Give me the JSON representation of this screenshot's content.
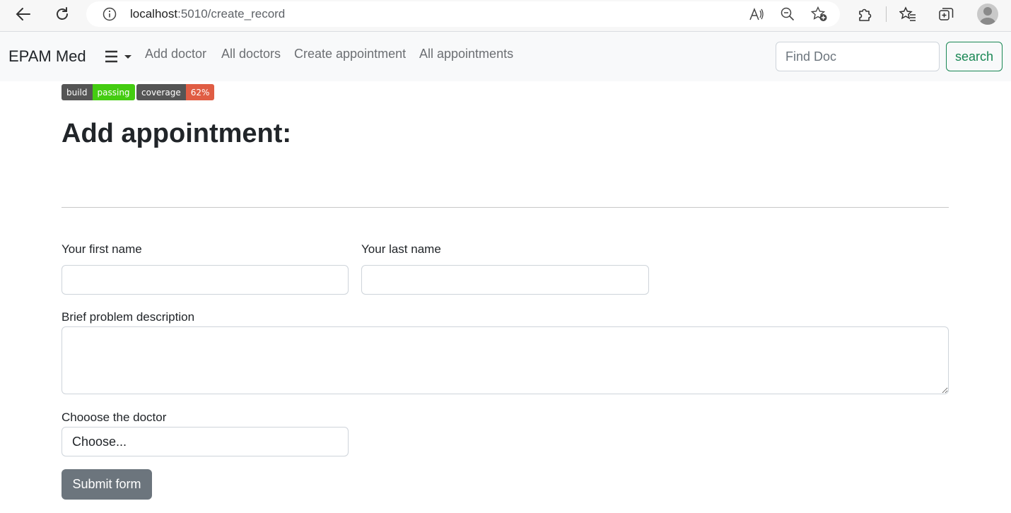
{
  "browser": {
    "url_host": "localhost",
    "url_path": ":5010/create_record",
    "icons": [
      "back-icon",
      "refresh-icon",
      "info-icon",
      "read-aloud-icon",
      "zoom-out-icon",
      "favorite-add-icon",
      "extensions-icon",
      "favorites-icon",
      "collections-icon",
      "profile-avatar"
    ]
  },
  "navbar": {
    "brand": "EPAM Med",
    "links": [
      "Add doctor",
      "All doctors",
      "Create appointment",
      "All appointments"
    ],
    "search_placeholder": "Find Doc",
    "search_button": "search"
  },
  "badges": [
    {
      "label": "build",
      "value": "passing",
      "color": "#4c1"
    },
    {
      "label": "coverage",
      "value": "62%",
      "color": "#e05d44"
    }
  ],
  "page": {
    "title": "Add appointment:"
  },
  "form": {
    "first_name_label": "Your first name",
    "first_name_value": "",
    "last_name_label": "Your last name",
    "last_name_value": "",
    "description_label": "Brief problem description",
    "description_value": "",
    "doctor_label": "Chooose the doctor",
    "doctor_selected": "Choose...",
    "submit_label": "Submit form"
  },
  "colors": {
    "navbar_bg": "#f8f9fa",
    "search_outline": "#198754",
    "submit_bg": "#6c757d"
  }
}
